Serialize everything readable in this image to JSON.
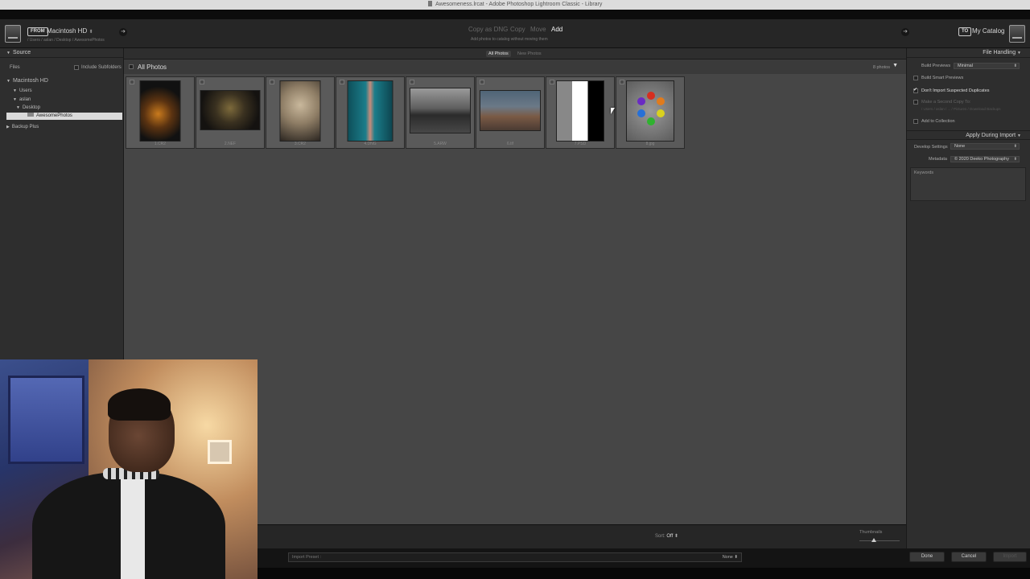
{
  "window": {
    "title": "Awesomeness.lrcat - Adobe Photoshop Lightroom Classic - Library"
  },
  "header": {
    "from_tag": "FROM",
    "source_drive": "Macintosh HD",
    "source_path": "/ Users / aslan / Desktop / AwesomePhotos",
    "modes": [
      {
        "label": "Copy as DNG",
        "active": false
      },
      {
        "label": "Copy",
        "active": false
      },
      {
        "label": "Move",
        "active": false
      },
      {
        "label": "Add",
        "active": true
      }
    ],
    "mode_description": "Add photos to catalog without moving them",
    "to_tag": "TO",
    "destination": "My Catalog"
  },
  "source_panel": {
    "title": "Source",
    "files_label": "Files",
    "include_subfolders": "Include Subfolders",
    "tree": [
      {
        "label": "Macintosh HD",
        "level": 0,
        "expanded": true,
        "selected": false
      },
      {
        "label": "Users",
        "level": 1,
        "expanded": true,
        "selected": false
      },
      {
        "label": "aslan",
        "level": 2,
        "expanded": true,
        "selected": false
      },
      {
        "label": "Desktop",
        "level": 3,
        "expanded": true,
        "selected": false
      },
      {
        "label": "AwesomePhotos",
        "level": 4,
        "expanded": false,
        "selected": true
      },
      {
        "label": "Backup Plus",
        "level": 0,
        "expanded": false,
        "selected": false
      }
    ]
  },
  "center": {
    "view_tabs": [
      {
        "label": "All Photos",
        "active": true
      },
      {
        "label": "New Photos",
        "active": false
      }
    ],
    "grid_title": "All Photos",
    "photo_count": "8 photos",
    "photos": [
      {
        "name": "1.CR2",
        "orientation": "portrait"
      },
      {
        "name": "2.NEF",
        "orientation": "landscape"
      },
      {
        "name": "3.CR2",
        "orientation": "portrait"
      },
      {
        "name": "4.DNG",
        "orientation": "portrait"
      },
      {
        "name": "5.ARW",
        "orientation": "landscape"
      },
      {
        "name": "6.tif",
        "orientation": "landscape"
      },
      {
        "name": "7.PSD",
        "orientation": "portrait"
      },
      {
        "name": "8.jpg",
        "orientation": "portrait"
      }
    ]
  },
  "file_handling": {
    "title": "File Handling",
    "build_previews_label": "Build Previews",
    "build_previews_value": "Minimal",
    "smart_previews": "Build Smart Previews",
    "no_duplicates": "Don't Import Suspected Duplicates",
    "second_copy": "Make a Second Copy To:",
    "second_copy_path": "/ Users / aslan / ... / Pictures / Download Backups",
    "add_collection": "Add to Collection"
  },
  "apply_during_import": {
    "title": "Apply During Import",
    "develop_label": "Develop Settings",
    "develop_value": "None",
    "metadata_label": "Metadata",
    "metadata_value": "© 2020 Deeko Photography",
    "keywords_label": "Keywords"
  },
  "toolbar": {
    "sort_label": "Sort:",
    "sort_value": "Off",
    "thumbnails_label": "Thumbnails",
    "thumbnail_size": 0.35
  },
  "bottom": {
    "import_preset_label": "Import Preset :",
    "import_preset_value": "None",
    "done": "Done",
    "cancel": "Cancel",
    "import": "Import"
  }
}
